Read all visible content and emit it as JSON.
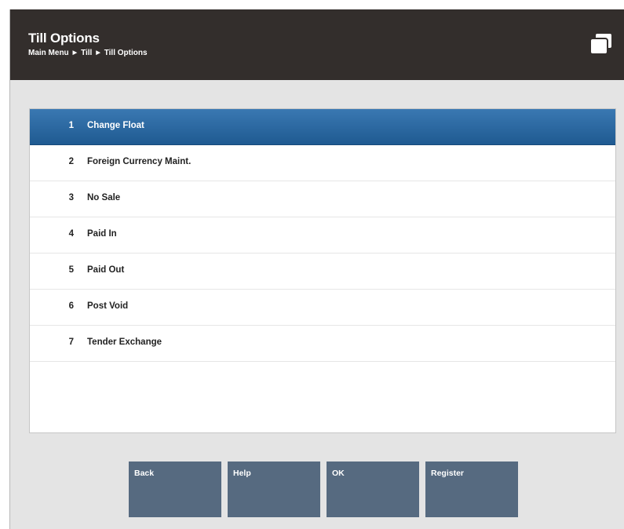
{
  "header": {
    "title": "Till Options",
    "breadcrumb": [
      "Main Menu",
      "Till",
      "Till Options"
    ],
    "icon": "windows-stack-icon"
  },
  "menu": {
    "items": [
      {
        "number": "1",
        "label": "Change Float",
        "selected": true
      },
      {
        "number": "2",
        "label": "Foreign Currency Maint."
      },
      {
        "number": "3",
        "label": "No Sale"
      },
      {
        "number": "4",
        "label": "Paid In"
      },
      {
        "number": "5",
        "label": "Paid Out"
      },
      {
        "number": "6",
        "label": "Post Void"
      },
      {
        "number": "7",
        "label": "Tender Exchange"
      }
    ]
  },
  "buttons": {
    "back": "Back",
    "help": "Help",
    "ok": "OK",
    "register": "Register"
  },
  "colors": {
    "header_bg": "#332e2c",
    "selected_row": "#2a6aa5",
    "button_bg": "#566a80",
    "background": "#e4e4e4"
  }
}
